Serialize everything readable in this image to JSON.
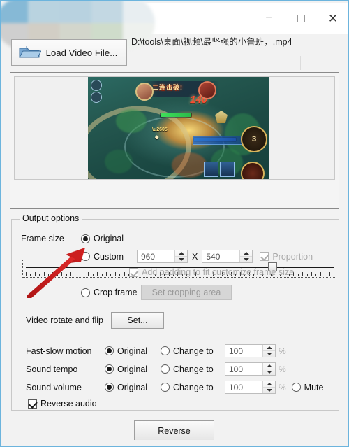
{
  "window": {
    "title_obscured": true,
    "controls": {
      "minimize": "–",
      "maximize": "maximize",
      "close": "✕"
    },
    "border_color": "#6cb4dd"
  },
  "toolbar": {
    "load_button_label": "Load Video File...",
    "load_button_icon": "folder-icon",
    "file_path": "D:\\tools\\桌面\\视频\\最坚强的小鲁班，.mp4"
  },
  "preview": {
    "thumbnail_caption": "二连击破!",
    "thumbnail_number": "140",
    "minimap_count": "3",
    "slider_position_percent": 78
  },
  "output_options": {
    "group_label": "Output options",
    "frame_size": {
      "label": "Frame size",
      "original_label": "Original",
      "original_selected": true,
      "custom_label": "Custom",
      "custom_selected": false,
      "width_value": "960",
      "separator": "X",
      "height_value": "540",
      "proportion_label": "Proportion",
      "proportion_checked": true,
      "proportion_disabled": true,
      "padding_label": "Add padding to fit customize frame size",
      "padding_checked": true,
      "padding_disabled": true,
      "crop_frame_label": "Crop frame",
      "crop_frame_selected": false,
      "set_cropping_area_label": "Set cropping area",
      "set_cropping_area_disabled": true
    },
    "rotate": {
      "label": "Video rotate and flip",
      "button_label": "Set..."
    },
    "fast_slow_motion": {
      "label": "Fast-slow motion",
      "original_label": "Original",
      "original_selected": true,
      "change_to_label": "Change to",
      "change_to_selected": false,
      "value": "100",
      "unit": "%"
    },
    "sound_tempo": {
      "label": "Sound tempo",
      "original_label": "Original",
      "original_selected": true,
      "change_to_label": "Change to",
      "change_to_selected": false,
      "value": "100",
      "unit": "%"
    },
    "sound_volume": {
      "label": "Sound volume",
      "original_label": "Original",
      "original_selected": true,
      "change_to_label": "Change to",
      "change_to_selected": false,
      "value": "100",
      "unit": "%",
      "mute_label": "Mute",
      "mute_selected": false
    },
    "reverse_audio": {
      "label": "Reverse audio",
      "checked": true
    }
  },
  "footer": {
    "reverse_button_label": "Reverse"
  },
  "annotation": {
    "arrow_color": "#cc2020",
    "points_at": "custom-radio"
  }
}
